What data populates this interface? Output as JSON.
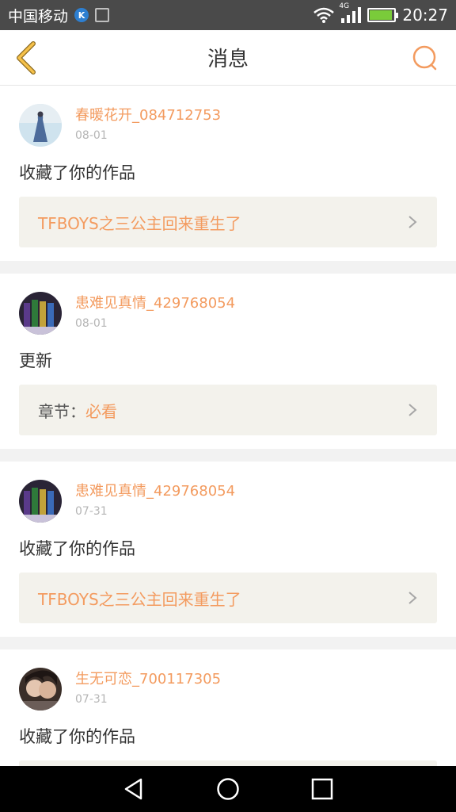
{
  "status_bar": {
    "carrier": "中国移动",
    "network": "4G",
    "time": "20:27",
    "battery_level": 0.85
  },
  "nav": {
    "title": "消息"
  },
  "messages": [
    {
      "username": "春暖花开_084712753",
      "date": "08-01",
      "action": "收藏了你的作品",
      "ref_label": "",
      "ref_value": "TFBOYS之三公主回来重生了"
    },
    {
      "username": "患难见真情_429768054",
      "date": "08-01",
      "action": "更新",
      "ref_label": "章节：",
      "ref_value": "必看"
    },
    {
      "username": "患难见真情_429768054",
      "date": "07-31",
      "action": "收藏了你的作品",
      "ref_label": "",
      "ref_value": "TFBOYS之三公主回来重生了"
    },
    {
      "username": "生无可恋_700117305",
      "date": "07-31",
      "action": "收藏了你的作品",
      "ref_label": "",
      "ref_value": ""
    }
  ],
  "colors": {
    "accent": "#f39b5f",
    "back_arrow": "#f5c14a",
    "card_ref_bg": "#f3f2ec"
  }
}
